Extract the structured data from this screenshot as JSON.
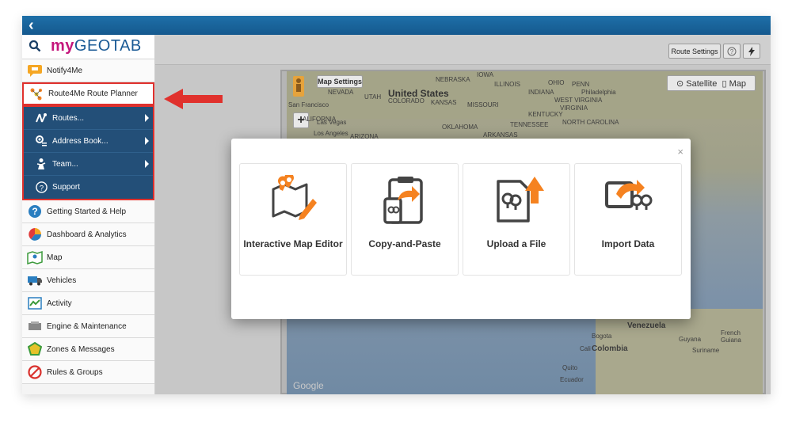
{
  "brand": {
    "prefix": "my",
    "name": "GEOTAB"
  },
  "sidebar": {
    "items": [
      {
        "label": "Notify4Me"
      },
      {
        "label": "Route4Me Route Planner"
      }
    ],
    "submenu": [
      {
        "label": "Routes..."
      },
      {
        "label": "Address Book..."
      },
      {
        "label": "Team..."
      },
      {
        "label": "Support"
      }
    ],
    "nav": [
      {
        "label": "Getting Started & Help"
      },
      {
        "label": "Dashboard & Analytics"
      },
      {
        "label": "Map"
      },
      {
        "label": "Vehicles"
      },
      {
        "label": "Activity"
      },
      {
        "label": "Engine & Maintenance"
      },
      {
        "label": "Zones & Messages"
      },
      {
        "label": "Rules & Groups"
      }
    ]
  },
  "toolbar": {
    "route_settings": "Route Settings",
    "help": "?",
    "bolt": "⚡"
  },
  "map": {
    "settings": "Map Settings",
    "satellite": "Satellite",
    "map_button": "Map",
    "zoom_in": "+",
    "labels": {
      "united_states": "United States",
      "san_francisco": "San Francisco",
      "los_angeles": "Los Angeles",
      "las_vegas": "Las Vegas",
      "nevada": "NEVADA",
      "utah": "UTAH",
      "colorado": "COLORADO",
      "kansas": "KANSAS",
      "nebraska": "NEBRASKA",
      "iowa": "IOWA",
      "illinois": "ILLINOIS",
      "indiana": "INDIANA",
      "ohio": "OHIO",
      "penn": "PENN",
      "missouri": "MISSOURI",
      "oklahoma": "OKLAHOMA",
      "arkansas": "ARKANSAS",
      "tennessee": "TENNESSEE",
      "kentucky": "KENTUCKY",
      "virginia": "VIRGINIA",
      "west_virginia": "WEST VIRGINIA",
      "north_carolina": "NORTH CAROLINA",
      "philadelphia": "Philadelphia",
      "arizona": "ARIZONA",
      "california": "ALIFORNIA",
      "venezuela": "Venezuela",
      "colombia": "Colombia",
      "bogota": "Bogota",
      "cali": "Cali",
      "quito": "Quito",
      "ecuador": "Ecuador",
      "guyana": "Guyana",
      "suriname": "Suriname",
      "french_guiana": "French Guiana",
      "google": "Google"
    }
  },
  "modal": {
    "close": "×",
    "cards": [
      {
        "label": "Interactive Map Editor"
      },
      {
        "label": "Copy-and-Paste"
      },
      {
        "label": "Upload a File"
      },
      {
        "label": "Import Data"
      }
    ]
  },
  "colors": {
    "accent_orange": "#f58220",
    "icon_dark": "#444444",
    "highlight_red": "#e0312d",
    "submenu_blue": "#234f78"
  }
}
